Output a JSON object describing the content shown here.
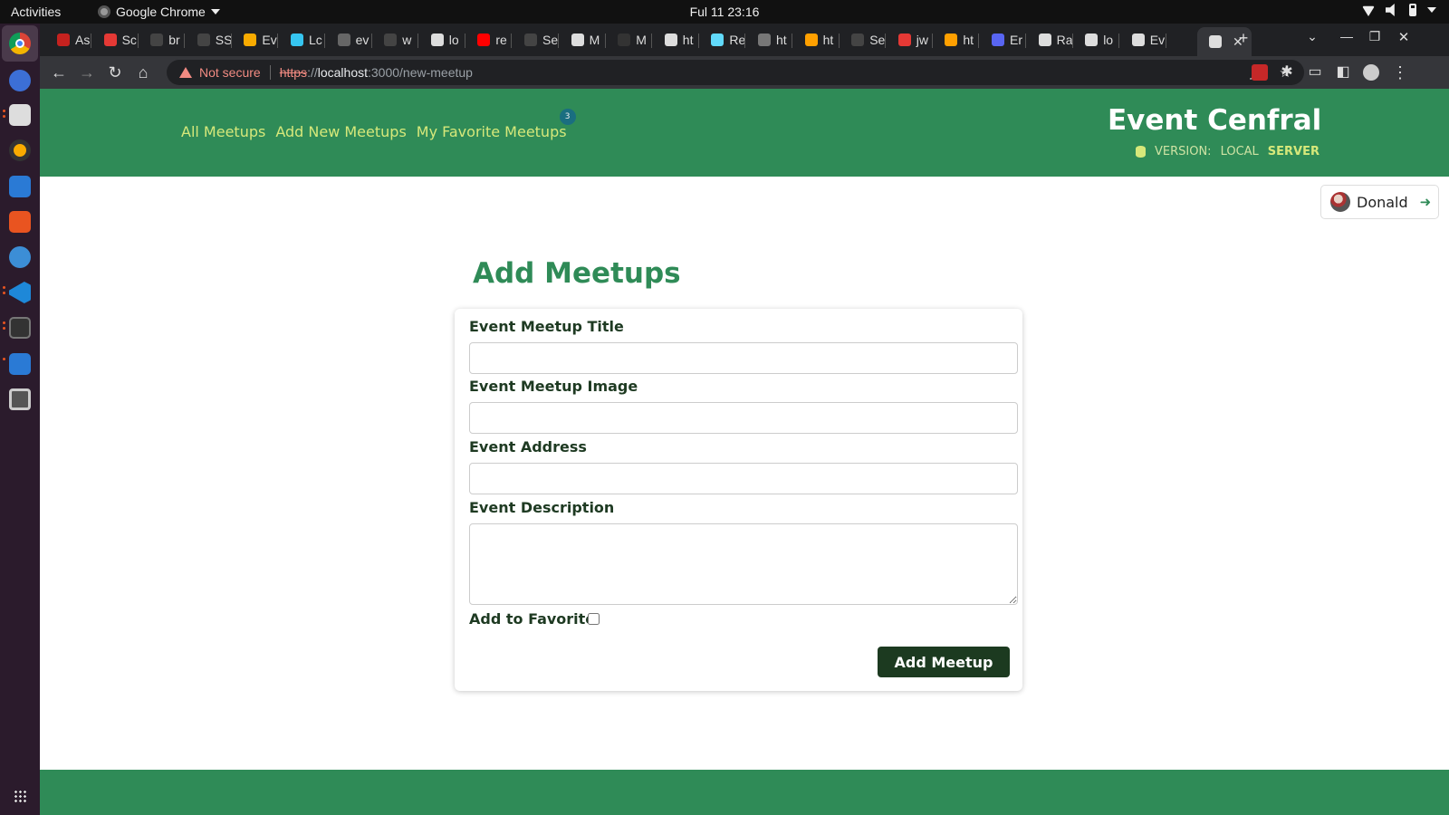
{
  "system": {
    "activities": "Activities",
    "app_name": "Google Chrome",
    "clock": "Ful 11  23:16"
  },
  "tabs": [
    {
      "label": "As",
      "icon": "gmail-icon",
      "color": "#c5221f"
    },
    {
      "label": "Sc",
      "icon": "ring-icon",
      "color": "#e53935"
    },
    {
      "label": "br",
      "icon": "github-icon",
      "color": "#444"
    },
    {
      "label": "SS",
      "icon": "github-icon",
      "color": "#444"
    },
    {
      "label": "Ev",
      "icon": "note-icon",
      "color": "#f9ab00"
    },
    {
      "label": "Lc",
      "icon": "slack-icon",
      "color": "#36c5f0"
    },
    {
      "label": "ev",
      "icon": "terminal-icon",
      "color": "#666"
    },
    {
      "label": "w",
      "icon": "github-icon",
      "color": "#444"
    },
    {
      "label": "lo",
      "icon": "globe-icon",
      "color": "#ddd"
    },
    {
      "label": "re",
      "icon": "youtube-icon",
      "color": "#ff0000"
    },
    {
      "label": "Se",
      "icon": "github-icon",
      "color": "#444"
    },
    {
      "label": "M",
      "icon": "handshake-icon",
      "color": "#ddd"
    },
    {
      "label": "M",
      "icon": "blank-icon",
      "color": "#333"
    },
    {
      "label": "ht",
      "icon": "globe-icon",
      "color": "#ddd"
    },
    {
      "label": "Re",
      "icon": "react-icon",
      "color": "#61dafb"
    },
    {
      "label": "ht",
      "icon": "api-icon",
      "color": "#777"
    },
    {
      "label": "ht",
      "icon": "firebase-icon",
      "color": "#ffa000"
    },
    {
      "label": "Se",
      "icon": "github-icon",
      "color": "#444"
    },
    {
      "label": "jw",
      "icon": "jw-icon",
      "color": "#e53935"
    },
    {
      "label": "ht",
      "icon": "firebase-icon",
      "color": "#ffa000"
    },
    {
      "label": "Er",
      "icon": "api-icon",
      "color": "#5865f2"
    },
    {
      "label": "Ra",
      "icon": "dev-icon",
      "color": "#ddd"
    },
    {
      "label": "lo",
      "icon": "globe-icon",
      "color": "#ddd"
    },
    {
      "label": "Ev",
      "icon": "handshake-icon",
      "color": "#ddd"
    }
  ],
  "active_tab_close": "✕",
  "new_tab": "+",
  "browser": {
    "not_secure": "Not secure",
    "protocol": "https",
    "url_host": "localhost",
    "url_rest": ":3000/new-meetup"
  },
  "site": {
    "nav": [
      {
        "label": "All Meetups"
      },
      {
        "label": "Add New Meetups"
      },
      {
        "label": "My Favorite Meetups"
      }
    ],
    "favorites_count": "3",
    "brand": "Event Cenfral",
    "version_label": "VERSION:",
    "version_local": "LOCAL",
    "version_server": "SERVER",
    "user_name": "Donald"
  },
  "form": {
    "page_title": "Add Meetups",
    "title_label": "Event Meetup Title",
    "title_value": "",
    "image_label": "Event Meetup Image",
    "image_value": "",
    "address_label": "Event Address",
    "address_value": "",
    "description_label": "Event Description",
    "description_value": "",
    "favorite_label": "Add to Favorite",
    "favorite_checked": false,
    "submit_label": "Add Meetup"
  },
  "colors": {
    "header_green": "#2f8b57",
    "nav_link": "#d6e87a",
    "submit_button": "#1c3a20",
    "chrome_dark": "#202124"
  }
}
